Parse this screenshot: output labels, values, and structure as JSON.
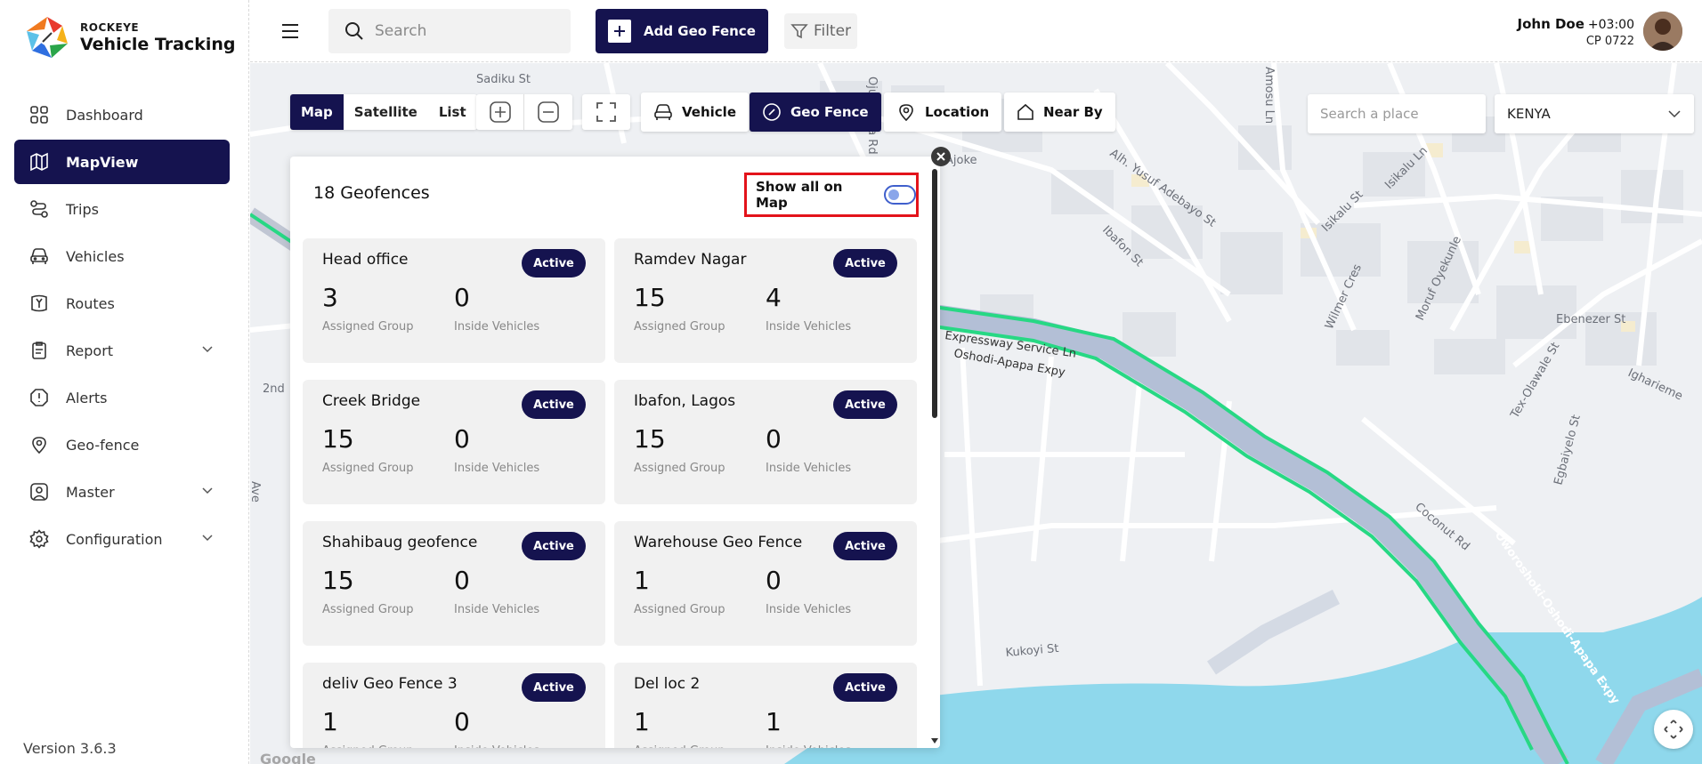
{
  "brand": {
    "small": "ROCKEYE",
    "name": "Vehicle Tracking"
  },
  "sidebar": {
    "items": [
      {
        "label": "Dashboard",
        "icon": "dashboard-icon"
      },
      {
        "label": "MapView",
        "icon": "map-icon",
        "active": true
      },
      {
        "label": "Trips",
        "icon": "trips-icon"
      },
      {
        "label": "Vehicles",
        "icon": "car-icon"
      },
      {
        "label": "Routes",
        "icon": "routes-icon"
      },
      {
        "label": "Report",
        "icon": "report-icon",
        "expandable": true
      },
      {
        "label": "Alerts",
        "icon": "alert-icon"
      },
      {
        "label": "Geo-fence",
        "icon": "location-pin-icon"
      },
      {
        "label": "Master",
        "icon": "user-icon",
        "expandable": true
      },
      {
        "label": "Configuration",
        "icon": "gear-icon",
        "expandable": true
      }
    ],
    "version": "Version 3.6.3"
  },
  "topbar": {
    "search_placeholder": "Search",
    "add_geo_fence": "Add Geo Fence",
    "filter": "Filter",
    "user_name": "John Doe",
    "user_tz": "+03:00",
    "user_sub": "CP 0722"
  },
  "map_controls": {
    "map_types": [
      "Map",
      "Satellite",
      "List"
    ],
    "active_map_type": "Map",
    "vehicle": "Vehicle",
    "geo_fence": "Geo Fence",
    "location": "Location",
    "near_by": "Near By",
    "search_place_placeholder": "Search a place",
    "country": "KENYA"
  },
  "map_labels": {
    "google": "Google",
    "streets": [
      "Sadiku St",
      "Ojuelegba Rd",
      "Amosu Ln",
      "Ajoke",
      "Alh. Yusuf Adebayo St",
      "Ibafon St",
      "Isikalu St",
      "Isikalu Ln",
      "Wilmer Cres",
      "Moruf Oyekunle",
      "Ebenezer St",
      "Tex-Olawale St",
      "Igharieme",
      "Egbaiyelo St",
      "Coconut Rd",
      "Oworoshoki-Oshodi-Apapa Expy",
      "Kukoyi St",
      "Expressway Service Ln",
      "Oshodi-Apapa Expy",
      "2nd",
      "Ave"
    ]
  },
  "geofence_panel": {
    "title": "18 Geofences",
    "show_all_label": "Show all on Map",
    "assigned_label": "Assigned Group",
    "inside_label": "Inside Vehicles",
    "status_label": "Active",
    "cards": [
      {
        "name": "Head office",
        "assigned": "3",
        "inside": "0"
      },
      {
        "name": "Ramdev Nagar",
        "assigned": "15",
        "inside": "4"
      },
      {
        "name": "Creek Bridge",
        "assigned": "15",
        "inside": "0"
      },
      {
        "name": "Ibafon, Lagos",
        "assigned": "15",
        "inside": "0"
      },
      {
        "name": "Shahibaug geofence",
        "assigned": "15",
        "inside": "0"
      },
      {
        "name": "Warehouse Geo Fence",
        "assigned": "1",
        "inside": "0"
      },
      {
        "name": "deliv Geo Fence 3",
        "assigned": "1",
        "inside": "0"
      },
      {
        "name": "Del loc 2",
        "assigned": "1",
        "inside": "1"
      }
    ]
  },
  "colors": {
    "primary": "#15134f",
    "highlight_red": "#e3131b",
    "route_green": "#27d884",
    "water": "#8fd8ec"
  }
}
